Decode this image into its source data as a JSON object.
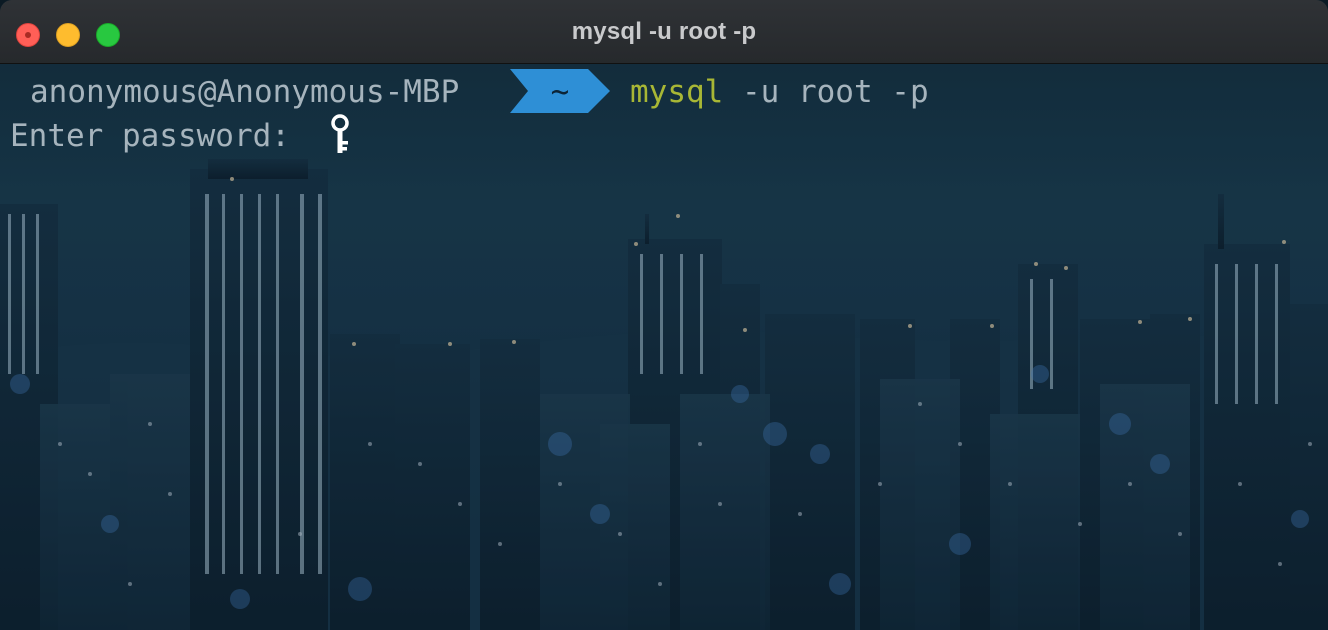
{
  "window": {
    "title": "mysql -u root -p"
  },
  "prompt": {
    "user_host": "anonymous@Anonymous-MBP",
    "cwd": "~",
    "command_program": "mysql",
    "command_args": " -u root -p"
  },
  "output": {
    "password_prompt": "Enter password: "
  },
  "icons": {
    "password_cursor": "key-icon"
  },
  "colors": {
    "close": "#ff5f57",
    "minimize": "#febc2e",
    "zoom": "#28c840",
    "prompt_segment": "#2e8fd6",
    "command": "#a8b735",
    "text": "#a6b4bd"
  }
}
